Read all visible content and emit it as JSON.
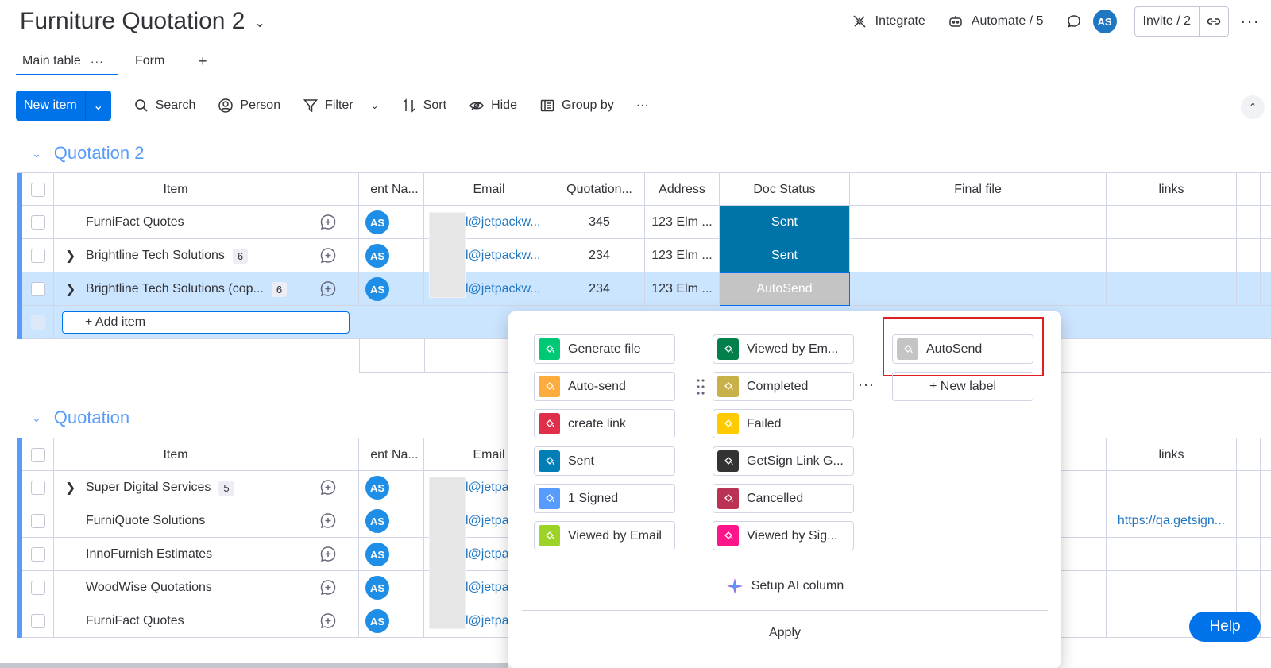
{
  "header": {
    "title": "Furniture Quotation 2",
    "integrate": "Integrate",
    "automate": "Automate / 5",
    "avatar": "AS",
    "invite": "Invite / 2"
  },
  "tabs": {
    "main": "Main table",
    "form": "Form",
    "add": "+"
  },
  "toolbar": {
    "new_item": "New item",
    "search": "Search",
    "person": "Person",
    "filter": "Filter",
    "sort": "Sort",
    "hide": "Hide",
    "group_by": "Group by"
  },
  "columns": {
    "item": "Item",
    "client": "ent Na...",
    "email": "Email",
    "quotation": "Quotation...",
    "address": "Address",
    "doc_status": "Doc Status",
    "final_file": "Final file",
    "links": "links"
  },
  "group1": {
    "title": "Quotation 2",
    "rows": [
      {
        "item": "FurniFact Quotes",
        "count": "",
        "person": "AS",
        "email": "l@jetpackw...",
        "quotation": "345",
        "address": "123 Elm ...",
        "status": "Sent",
        "links": ""
      },
      {
        "item": "Brightline Tech Solutions",
        "count": "6",
        "person": "AS",
        "email": "l@jetpackw...",
        "quotation": "234",
        "address": "123 Elm ...",
        "status": "Sent",
        "links": ""
      },
      {
        "item": "Brightline Tech Solutions (cop...",
        "count": "6",
        "person": "AS",
        "email": "l@jetpackw...",
        "quotation": "234",
        "address": "123 Elm ...",
        "status": "AutoSend",
        "links": ""
      }
    ],
    "add_item": "+ Add item"
  },
  "group2": {
    "title": "Quotation",
    "rows": [
      {
        "item": "Super Digital Services",
        "count": "5",
        "person": "AS",
        "email": "l@jetpa",
        "links": ""
      },
      {
        "item": "FurniQuote Solutions",
        "count": "",
        "person": "AS",
        "email": "l@jetpa",
        "links": "https://qa.getsign..."
      },
      {
        "item": "InnoFurnish Estimates",
        "count": "",
        "person": "AS",
        "email": "l@jetpa",
        "links": ""
      },
      {
        "item": "WoodWise Quotations",
        "count": "",
        "person": "AS",
        "email": "l@jetpa",
        "links": ""
      },
      {
        "item": "FurniFact Quotes",
        "count": "",
        "person": "AS",
        "email": "l@jetpa",
        "links": ""
      }
    ]
  },
  "popover": {
    "labels": [
      {
        "text": "Generate file",
        "color": "#00c875"
      },
      {
        "text": "Auto-send",
        "color": "#fdab3d"
      },
      {
        "text": "create link",
        "color": "#df2f4a"
      },
      {
        "text": "Sent",
        "color": "#007eb5"
      },
      {
        "text": "1 Signed",
        "color": "#579bfc"
      },
      {
        "text": "Viewed by Email",
        "color": "#9cd326"
      },
      {
        "text": "Viewed by Em...",
        "color": "#037f4c"
      },
      {
        "text": "Completed",
        "color": "#c9b149"
      },
      {
        "text": "Failed",
        "color": "#ffcb00"
      },
      {
        "text": "GetSign Link G...",
        "color": "#333333"
      },
      {
        "text": "Cancelled",
        "color": "#bb3354"
      },
      {
        "text": "Viewed by Sig...",
        "color": "#ff158a"
      },
      {
        "text": "AutoSend",
        "color": "#c4c4c4"
      }
    ],
    "new_label": "+ New label",
    "ai": "Setup AI column",
    "apply": "Apply"
  },
  "help": "Help",
  "colors": {
    "accent": "#0073ea",
    "group": "#579bfc",
    "sent": "#037f4c",
    "autosend": "#c4c4c4",
    "highlight": "#e02020"
  }
}
